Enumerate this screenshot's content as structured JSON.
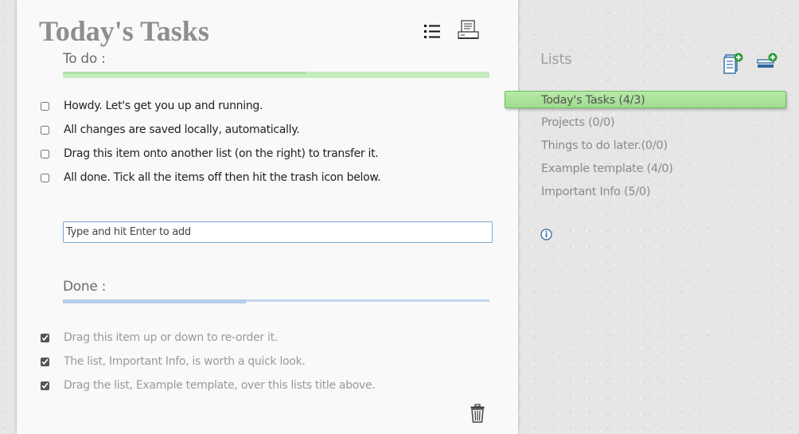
{
  "main": {
    "title": "Today's Tasks",
    "todo_heading": "To do :",
    "done_heading": "Done :",
    "todo_progress": 0.57,
    "done_progress": 0.43,
    "add_placeholder": "Type and hit Enter to add",
    "todo_items": [
      "Howdy. Let's get you up and running.",
      "All changes are saved locally, automatically.",
      "Drag this item onto another list (on the right) to transfer it.",
      "All done. Tick all the items off then hit the trash icon below."
    ],
    "done_items": [
      "Drag this item up or down to re-order it.",
      "The list, Important Info, is worth a quick look.",
      "Drag the list, Example template, over this lists title above."
    ],
    "icons": {
      "list_view": "list-view-icon",
      "print": "print-icon",
      "trash": "trash-icon"
    }
  },
  "sidebar": {
    "heading": "Lists",
    "lists": [
      "Today's Tasks (4/3)",
      "Projects (0/0)",
      "Things to do later.(0/0)",
      "Example template (4/0)",
      "Important Info (5/0)"
    ],
    "active_index": 0,
    "icons": {
      "new_list": "new-list-icon",
      "new_template": "new-template-icon",
      "info": "info-icon"
    }
  },
  "colors": {
    "active_list": "#a8e29a",
    "todo_bar": "#c5edbe",
    "done_bar": "#b4cdeb",
    "input_border": "#7ea2d6"
  }
}
